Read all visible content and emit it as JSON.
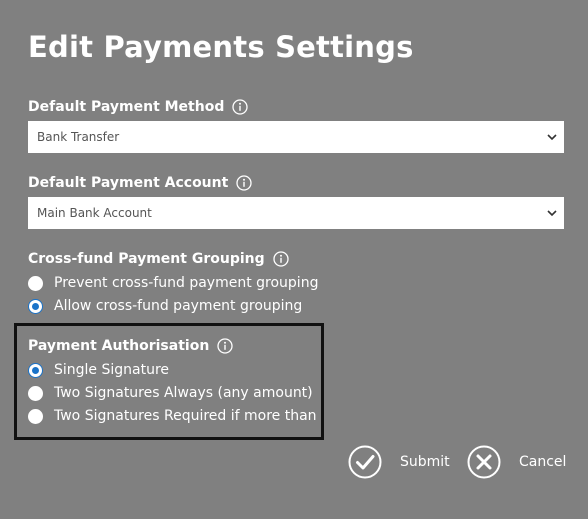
{
  "dialog": {
    "title": "Edit Payments Settings"
  },
  "payment_method": {
    "label": "Default Payment Method",
    "value": "Bank Transfer"
  },
  "payment_account": {
    "label": "Default Payment Account",
    "value": "Main Bank Account"
  },
  "cross_fund": {
    "label": "Cross-fund Payment Grouping",
    "options": [
      {
        "label": "Prevent cross-fund payment grouping",
        "checked": false
      },
      {
        "label": "Allow cross-fund payment grouping",
        "checked": true
      }
    ]
  },
  "authorisation": {
    "label": "Payment Authorisation",
    "options": [
      {
        "label": "Single Signature",
        "checked": true
      },
      {
        "label": "Two Signatures Always (any amount)",
        "checked": false
      },
      {
        "label": "Two Signatures Required if more than",
        "checked": false
      }
    ]
  },
  "actions": {
    "submit_label": "Submit",
    "cancel_label": "Cancel"
  },
  "colors": {
    "background": "#808080",
    "accent": "#1a73c9",
    "highlight_border": "#111111"
  },
  "icons": {
    "info": "info-icon",
    "dropdown": "chevron-down-icon",
    "submit": "check-circle-icon",
    "cancel": "x-circle-icon"
  }
}
